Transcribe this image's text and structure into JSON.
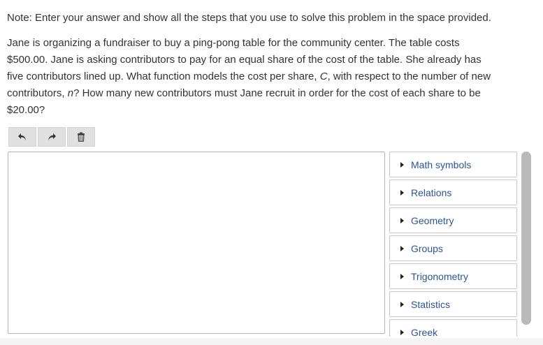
{
  "note": "Note: Enter your answer and show all the steps that you use to solve this problem in the space provided.",
  "problem": {
    "lines": [
      "Jane is organizing a fundraiser to buy a ping-pong table for the community center. The table costs",
      "$500.00. Jane is asking contributors to pay for an equal share of the cost of the table. She already has",
      "five contributors lined up. What function models the cost per share,",
      "contributors,",
      "$20.00?"
    ],
    "line3_var": "C",
    "line3_tail": ", with respect to the number of new",
    "line4_var": "n",
    "line4_tail": "? How many new contributors must Jane recruit in order for the cost of each share to be"
  },
  "toolbar": {
    "undo_icon": "undo-icon",
    "redo_icon": "redo-icon",
    "delete_icon": "trash-icon"
  },
  "palette": {
    "items": [
      {
        "label": "Math symbols"
      },
      {
        "label": "Relations"
      },
      {
        "label": "Geometry"
      },
      {
        "label": "Groups"
      },
      {
        "label": "Trigonometry"
      },
      {
        "label": "Statistics"
      },
      {
        "label": "Greek"
      }
    ]
  },
  "colors": {
    "palette_text": "#2a5596",
    "toolbar_bg": "#e0e0e0",
    "scrollbar": "#b9b9b9"
  }
}
